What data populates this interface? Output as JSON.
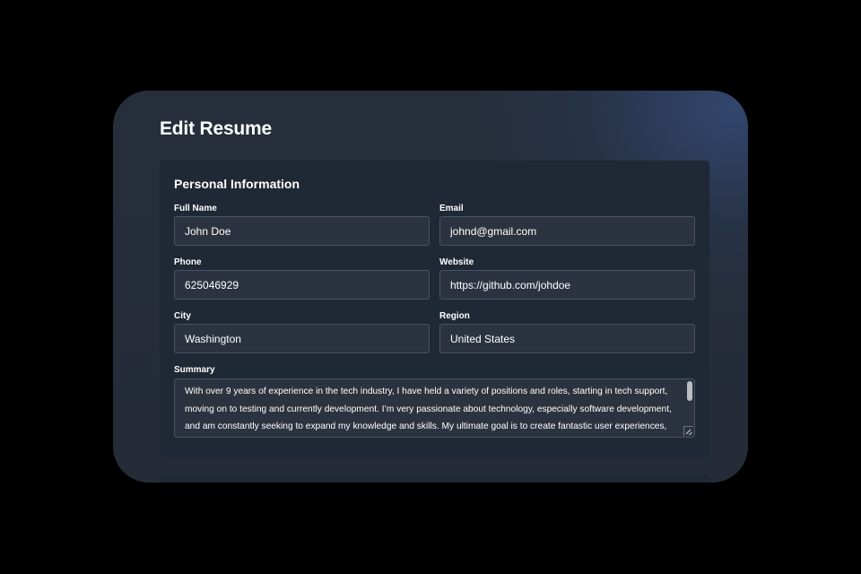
{
  "page": {
    "title": "Edit Resume"
  },
  "personal_info": {
    "section_title": "Personal Information",
    "full_name": {
      "label": "Full Name",
      "value": "John Doe"
    },
    "email": {
      "label": "Email",
      "value": "johnd@gmail.com"
    },
    "phone": {
      "label": "Phone",
      "value": "625046929"
    },
    "website": {
      "label": "Website",
      "value": "https://github.com/johdoe"
    },
    "city": {
      "label": "City",
      "value": "Washington"
    },
    "region": {
      "label": "Region",
      "value": "United States"
    },
    "summary": {
      "label": "Summary",
      "value": "With over 9 years of experience in the tech industry, I have held a variety of positions and roles, starting in tech support, moving on to testing and currently development. I’m very passionate about technology, especially software development, and am constantly seeking to expand my knowledge and skills. My ultimate goal is to create fantastic user experiences,"
    }
  },
  "colors": {
    "page_background": "#000000",
    "window_background": "#262e3b",
    "section_background": "#1f2835",
    "input_background": "#2c3340",
    "input_border": "#4a5261",
    "text": "#ffffff"
  },
  "icons": [
    "scrollbar-thumb",
    "resize-handle-icon"
  ]
}
